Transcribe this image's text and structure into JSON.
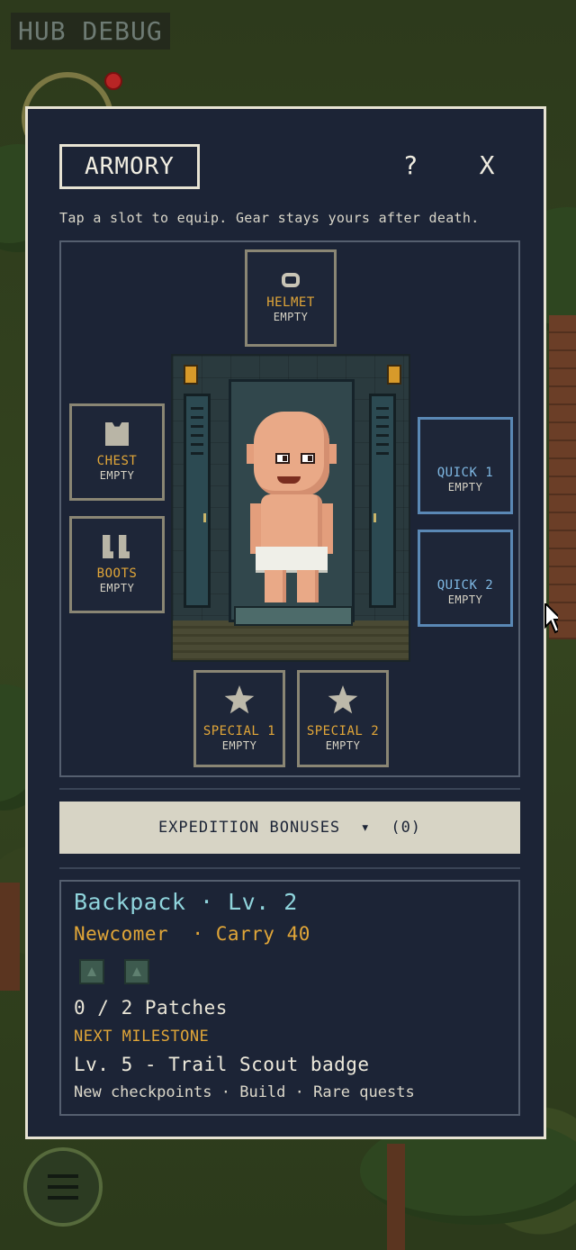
{
  "hud": {
    "debug_label": "HUB DEBUG"
  },
  "armory": {
    "title": "ARMORY",
    "help_glyph": "?",
    "close_glyph": "X",
    "hint": "Tap a slot to equip. Gear stays yours after death.",
    "slots": {
      "helmet": {
        "label": "HELMET",
        "state": "EMPTY",
        "icon": "helmet-icon"
      },
      "chest": {
        "label": "CHEST",
        "state": "EMPTY",
        "icon": "chest-armor-icon"
      },
      "boots": {
        "label": "BOOTS",
        "state": "EMPTY",
        "icon": "boots-icon"
      },
      "quick1": {
        "label": "QUICK 1",
        "state": "EMPTY"
      },
      "quick2": {
        "label": "QUICK 2",
        "state": "EMPTY"
      },
      "special1": {
        "label": "SPECIAL 1",
        "state": "EMPTY",
        "icon": "star-icon"
      },
      "special2": {
        "label": "SPECIAL 2",
        "state": "EMPTY",
        "icon": "star-icon"
      }
    },
    "bonuses_button": "EXPEDITION BONUSES  ▾  (0)",
    "backpack": {
      "title": "Backpack · Lv. 2",
      "subtitle": "Newcomer  · Carry 40",
      "badges": [
        "patch-slot-icon",
        "patch-slot-icon"
      ],
      "patches": "0 / 2 Patches",
      "milestone_label": "NEXT MILESTONE",
      "milestone_value": "Lv. 5 - Trail Scout badge",
      "milestone_perks": "New checkpoints · Build · Rare quests"
    }
  },
  "colors": {
    "modal_bg": "#1c2436",
    "accent_orange": "#e1a638",
    "accent_cyan": "#8fd4dc",
    "quick_slot_border": "#5a88b5",
    "bonus_button_bg": "#d7d4c5"
  }
}
